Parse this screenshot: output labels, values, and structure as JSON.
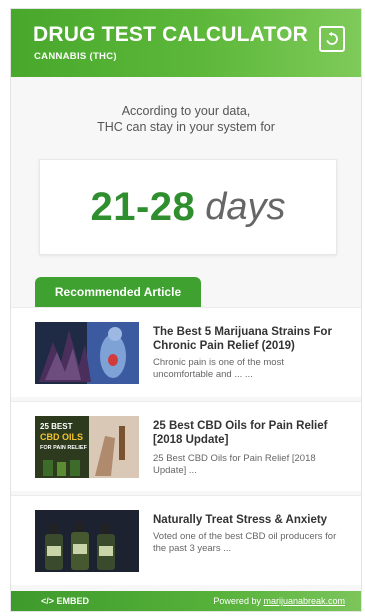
{
  "header": {
    "title": "DRUG TEST CALCULATOR",
    "subtitle": "CANNABIS (THC)",
    "reset_icon": "reset-icon"
  },
  "intro": {
    "line1": "According to your data,",
    "line2": "THC can stay in your system for"
  },
  "result": {
    "range": "21-28",
    "unit": "days"
  },
  "recommended": {
    "tab_label": "Recommended Article",
    "articles": [
      {
        "title": "The Best 5 Marijuana Strains For Chronic Pain Relief (2019)",
        "desc": "Chronic pain is one of the most uncomfortable and ... ..."
      },
      {
        "title": "25 Best CBD Oils for Pain Relief [2018 Update]",
        "desc": "25 Best CBD Oils for Pain Relief [2018 Update] ...",
        "thumb_text_1": "25 BEST",
        "thumb_text_2": "CBD OILS",
        "thumb_text_3": "FOR PAIN RELIEF"
      },
      {
        "title": "Naturally Treat Stress & Anxiety",
        "desc": "Voted one of the best CBD oil producers for the past 3 years ..."
      }
    ]
  },
  "footer": {
    "embed_label": "</> EMBED",
    "powered_prefix": "Powered by ",
    "powered_link": "marijuanabreak.com"
  },
  "colors": {
    "brand_green": "#3fa12f",
    "result_green": "#2f8f2f"
  }
}
